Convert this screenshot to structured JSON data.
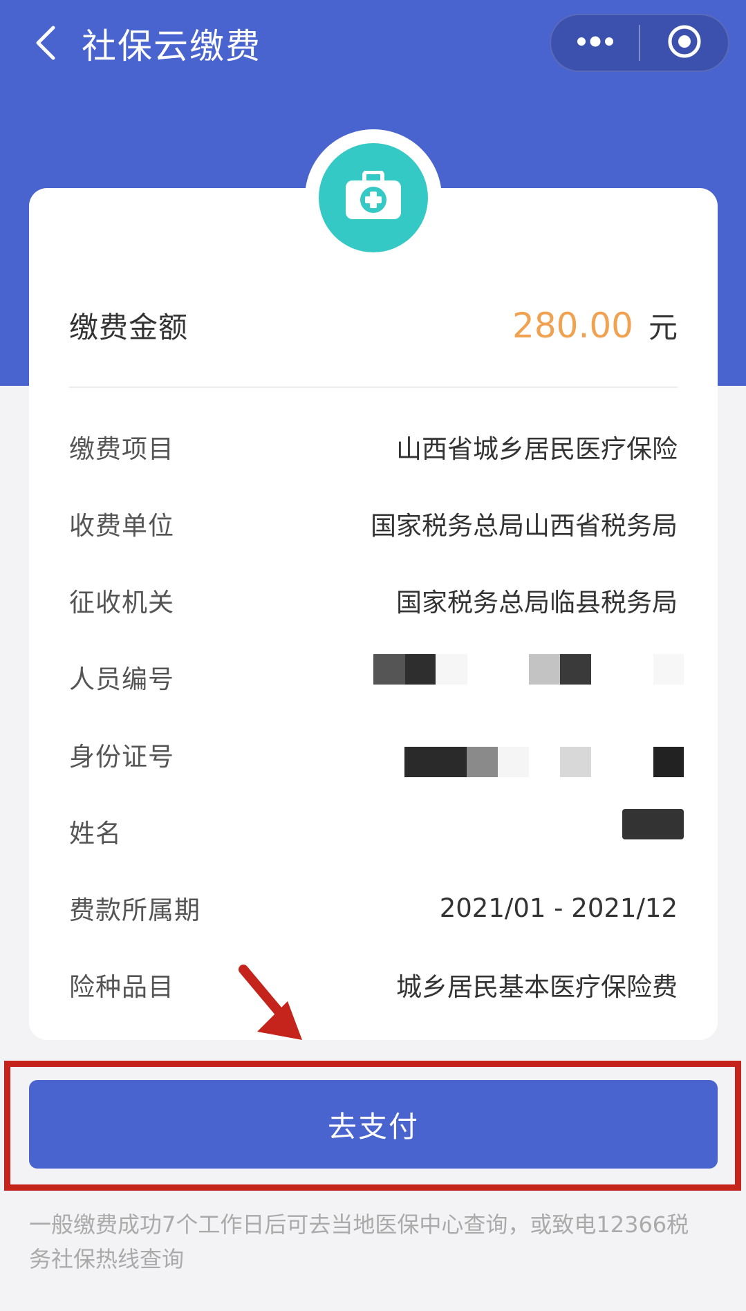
{
  "nav": {
    "title": "社保云缴费",
    "back_icon": "chevron-left-icon",
    "more_icon": "more-dots-icon",
    "close_icon": "target-circle-icon"
  },
  "card": {
    "badge_icon": "medical-kit-icon",
    "amount_label": "缴费金额",
    "amount_value": "280.00",
    "amount_unit": "元",
    "rows": [
      {
        "label": "缴费项目",
        "value": "山西省城乡居民医疗保险"
      },
      {
        "label": "收费单位",
        "value": "国家税务总局山西省税务局"
      },
      {
        "label": "征收机关",
        "value": "国家税务总局临县税务局"
      },
      {
        "label": "人员编号",
        "value": ""
      },
      {
        "label": "身份证号",
        "value": ""
      },
      {
        "label": "姓名",
        "value": ""
      },
      {
        "label": "费款所属期",
        "value": "2021/01 - 2021/12"
      },
      {
        "label": "险种品目",
        "value": "城乡居民基本医疗保险费"
      }
    ]
  },
  "action": {
    "pay_label": "去支付"
  },
  "footnote": "一般缴费成功7个工作日后可去当地医保中心查询，或致电12366税务社保热线查询",
  "colors": {
    "primary": "#4a64cf",
    "amount": "#f0a251",
    "badge": "#35c9c6",
    "highlight": "#c4241b"
  }
}
